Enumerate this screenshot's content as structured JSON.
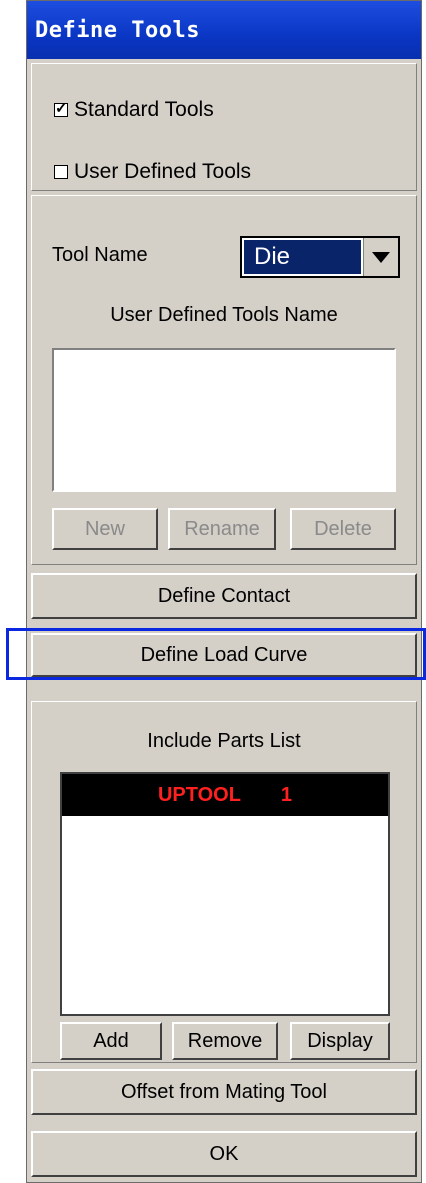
{
  "window": {
    "title": "Define Tools"
  },
  "options": {
    "standard_tools": {
      "label": "Standard Tools",
      "checked": true
    },
    "user_defined_tools": {
      "label": "User Defined Tools",
      "checked": false
    }
  },
  "tool_panel": {
    "tool_name_label": "Tool Name",
    "tool_name_value": "Die",
    "user_defined_label": "User Defined Tools Name",
    "buttons": {
      "new": "New",
      "rename": "Rename",
      "delete": "Delete"
    }
  },
  "actions": {
    "define_contact": "Define Contact",
    "define_load_curve": "Define Load Curve",
    "offset_from_mating_tool": "Offset from Mating Tool",
    "ok": "OK"
  },
  "parts_panel": {
    "title": "Include Parts List",
    "items": [
      {
        "name": "UPTOOL",
        "id": "1"
      }
    ],
    "buttons": {
      "add": "Add",
      "remove": "Remove",
      "display": "Display"
    }
  }
}
